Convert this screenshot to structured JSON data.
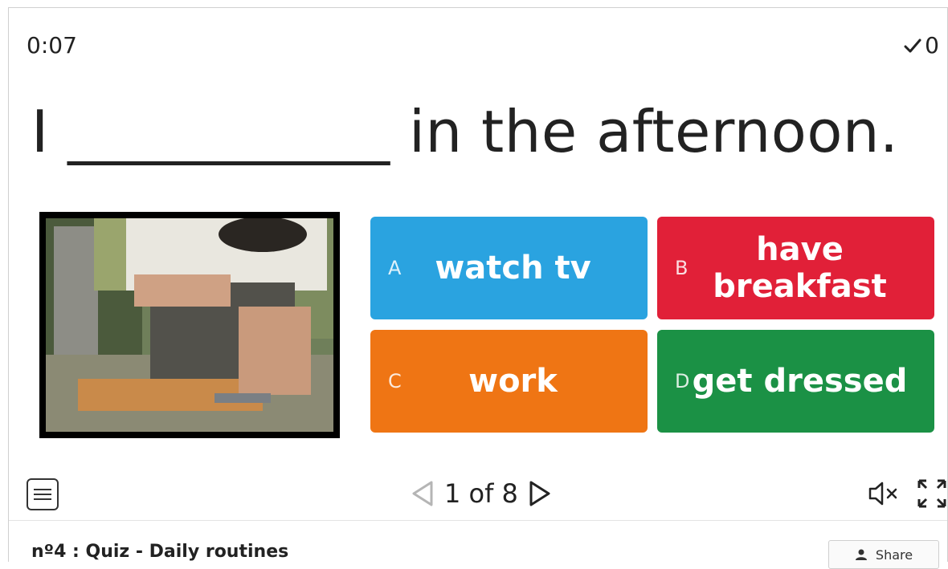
{
  "header": {
    "timer": "0:07",
    "score": "0"
  },
  "question": {
    "text": "I ___________ in the afternoon."
  },
  "answers": [
    {
      "letter": "A",
      "text": "watch tv",
      "color": "#2aa3e0"
    },
    {
      "letter": "B",
      "text": "have breakfast",
      "color": "#e12038"
    },
    {
      "letter": "C",
      "text": "work",
      "color": "#ef7514"
    },
    {
      "letter": "D",
      "text": "get dressed",
      "color": "#1b9145"
    }
  ],
  "controls": {
    "pager": "1 of 8"
  },
  "footer": {
    "title": "nº4 : Quiz - Daily routines",
    "share_label": "Share"
  }
}
